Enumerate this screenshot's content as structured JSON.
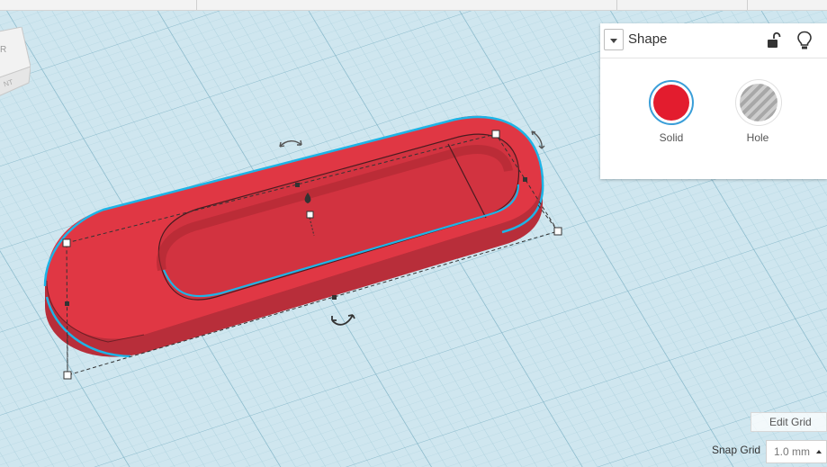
{
  "panel": {
    "title": "Shape",
    "solid_label": "Solid",
    "hole_label": "Hole",
    "solid_color": "#e31c2e"
  },
  "grid": {
    "edit_label": "Edit Grid",
    "snap_label": "Snap Grid",
    "snap_value": "1.0 mm"
  },
  "viewcube": {
    "face_label": "NT",
    "top_letter": "R"
  },
  "icons": {
    "lock": "unlock-icon",
    "bulb": "lightbulb-icon",
    "rotate": "rotate-arrow-icon",
    "height": "height-drop-icon"
  },
  "colors": {
    "workplane": "#cfe6ef",
    "grid_minor": "#a9cfdc",
    "grid_major": "#7fb3c6",
    "shape_top": "#e03744",
    "shape_side": "#b82e3a",
    "selection": "#1eb4e6"
  }
}
